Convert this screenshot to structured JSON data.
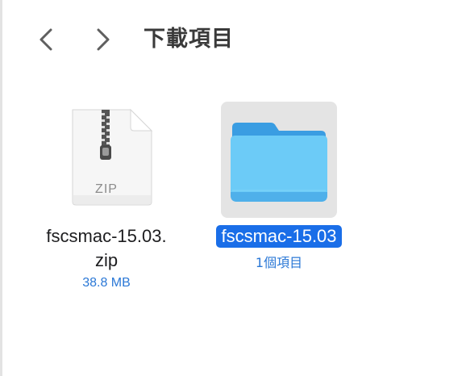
{
  "toolbar": {
    "title": "下載項目",
    "back_icon": "chevron-left-icon",
    "forward_icon": "chevron-right-icon"
  },
  "files": [
    {
      "name": "fscsmac-15.03.zip",
      "detail": "38.8 MB",
      "icon": "zip-file-icon",
      "icon_label": "ZIP",
      "selected": false
    },
    {
      "name": "fscsmac-15.03",
      "detail": "1個項目",
      "icon": "folder-icon",
      "selected": true
    }
  ],
  "colors": {
    "selection": "#1a6ee8",
    "detail_text": "#2b78d6",
    "folder_body": "#6ccbf7",
    "folder_tab": "#3a9de2"
  }
}
